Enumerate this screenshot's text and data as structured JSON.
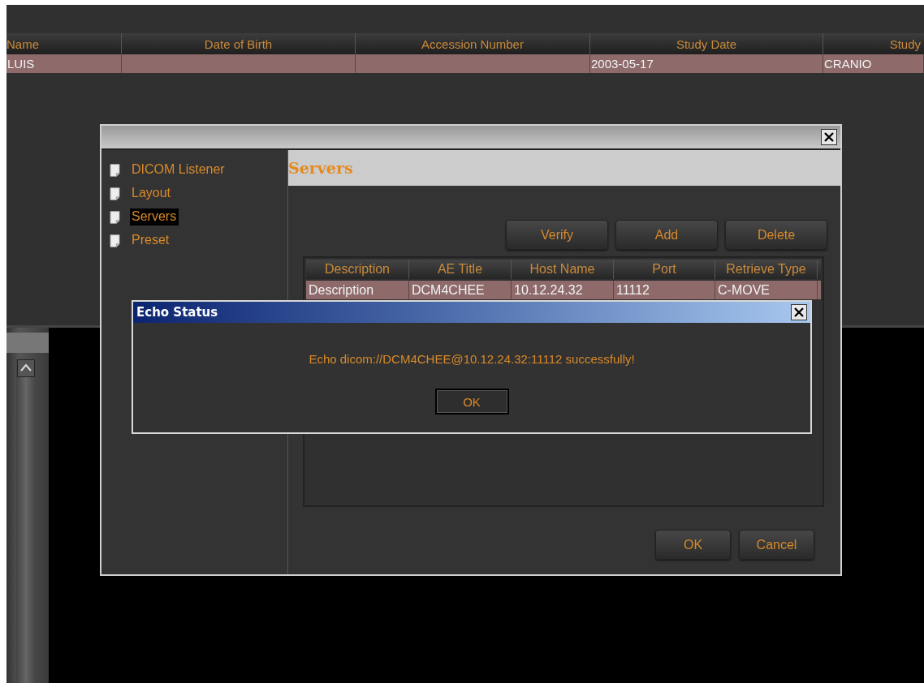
{
  "study_table": {
    "columns": [
      "Name",
      "Date of Birth",
      "Accession Number",
      "Study Date",
      "Study"
    ],
    "rows": [
      {
        "selected": true,
        "cells": [
          "LUIS",
          "",
          "",
          "2003-05-17",
          "CRANIO"
        ]
      }
    ]
  },
  "settings_dialog": {
    "nav": [
      {
        "label": "DICOM Listener",
        "selected": false
      },
      {
        "label": "Layout",
        "selected": false
      },
      {
        "label": "Servers",
        "selected": true
      },
      {
        "label": "Preset",
        "selected": false
      }
    ],
    "section_title": "Servers",
    "actions": [
      "Verify",
      "Add",
      "Delete"
    ],
    "servers_table": {
      "columns": [
        "Description",
        "AE Title",
        "Host Name",
        "Port",
        "Retrieve Type"
      ],
      "rows": [
        {
          "selected": true,
          "cells": [
            "Description",
            "DCM4CHEE",
            "10.12.24.32",
            "11112",
            "C-MOVE"
          ]
        }
      ]
    },
    "buttons": [
      "OK",
      "Cancel"
    ]
  },
  "echo_dialog": {
    "title": "Echo Status",
    "message": "Echo dicom://DCM4CHEE@10.12.24.32:11112 successfully!",
    "button": "OK"
  }
}
